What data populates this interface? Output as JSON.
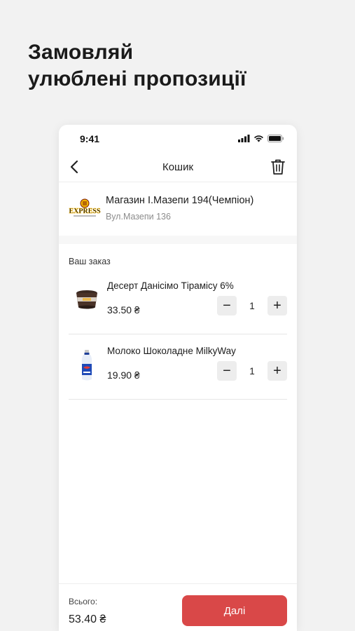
{
  "headline": {
    "line1": "Замовляй",
    "line2": "улюблені пропозиції"
  },
  "status_bar": {
    "time": "9:41",
    "icons": [
      "signal-icon",
      "wifi-icon",
      "battery-icon"
    ]
  },
  "nav": {
    "title": "Кошик",
    "back_icon": "chevron-left-icon",
    "trash_icon": "trash-icon"
  },
  "store": {
    "name": "Магазин І.Мазепи 194(Чемпіон)",
    "address": "Вул.Мазепи 136",
    "logo_text": "EXPRESS"
  },
  "order": {
    "section_label": "Ваш заказ",
    "items": [
      {
        "name": "Десерт Данісімо Тірамісу 6%",
        "price": "33.50 ₴",
        "qty": "1",
        "minus": "−",
        "plus": "+"
      },
      {
        "name": "Молоко Шоколадне MilkyWay",
        "price": "19.90 ₴",
        "qty": "1",
        "minus": "−",
        "plus": "+"
      }
    ]
  },
  "footer": {
    "total_label": "Всього:",
    "total_value": "53.40 ₴",
    "next_label": "Далі"
  },
  "colors": {
    "accent": "#d94848",
    "background": "#f2f2f2"
  }
}
